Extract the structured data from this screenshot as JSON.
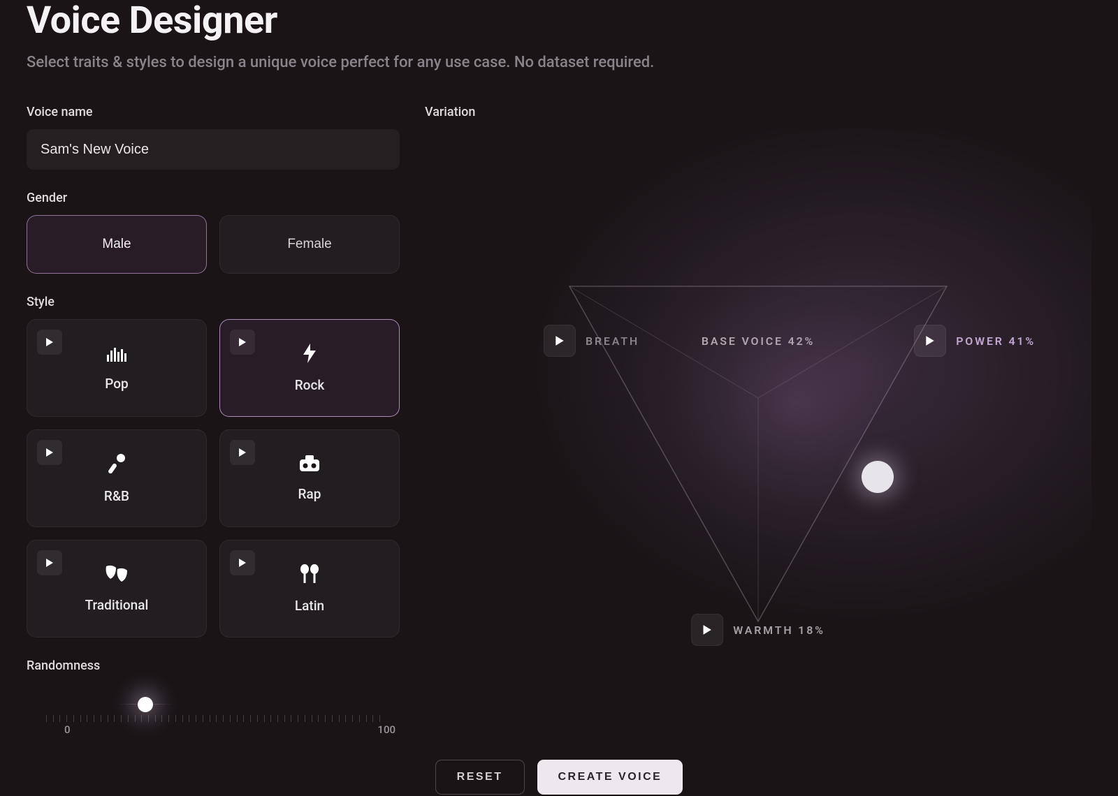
{
  "page": {
    "title": "Voice Designer",
    "subtitle": "Select traits & styles to design a unique voice perfect for any use case. No dataset required."
  },
  "voice_name": {
    "label": "Voice name",
    "value": "Sam's New Voice"
  },
  "gender": {
    "label": "Gender",
    "options": [
      "Male",
      "Female"
    ],
    "selected": "Male"
  },
  "style": {
    "label": "Style",
    "options": [
      {
        "id": "pop",
        "label": "Pop",
        "icon": "equalizer-icon"
      },
      {
        "id": "rock",
        "label": "Rock",
        "icon": "bolt-icon"
      },
      {
        "id": "rnb",
        "label": "R&B",
        "icon": "mic-icon"
      },
      {
        "id": "rap",
        "label": "Rap",
        "icon": "boombox-icon"
      },
      {
        "id": "traditional",
        "label": "Traditional",
        "icon": "masks-icon"
      },
      {
        "id": "latin",
        "label": "Latin",
        "icon": "maracas-icon"
      }
    ],
    "selected": "rock"
  },
  "randomness": {
    "label": "Randomness",
    "min": 0,
    "max": 100,
    "value": 30
  },
  "variation": {
    "label": "Variation",
    "corners": {
      "breath": {
        "label": "BREATH",
        "display": "BREATH"
      },
      "power": {
        "label": "POWER",
        "value": 41,
        "display": "POWER 41%"
      },
      "warmth": {
        "label": "WARMTH",
        "value": 18,
        "display": "WARMTH 18%"
      }
    },
    "base_voice": {
      "value": 42,
      "display": "BASE VOICE 42%"
    }
  },
  "actions": {
    "reset": "RESET",
    "create": "CREATE VOICE"
  }
}
